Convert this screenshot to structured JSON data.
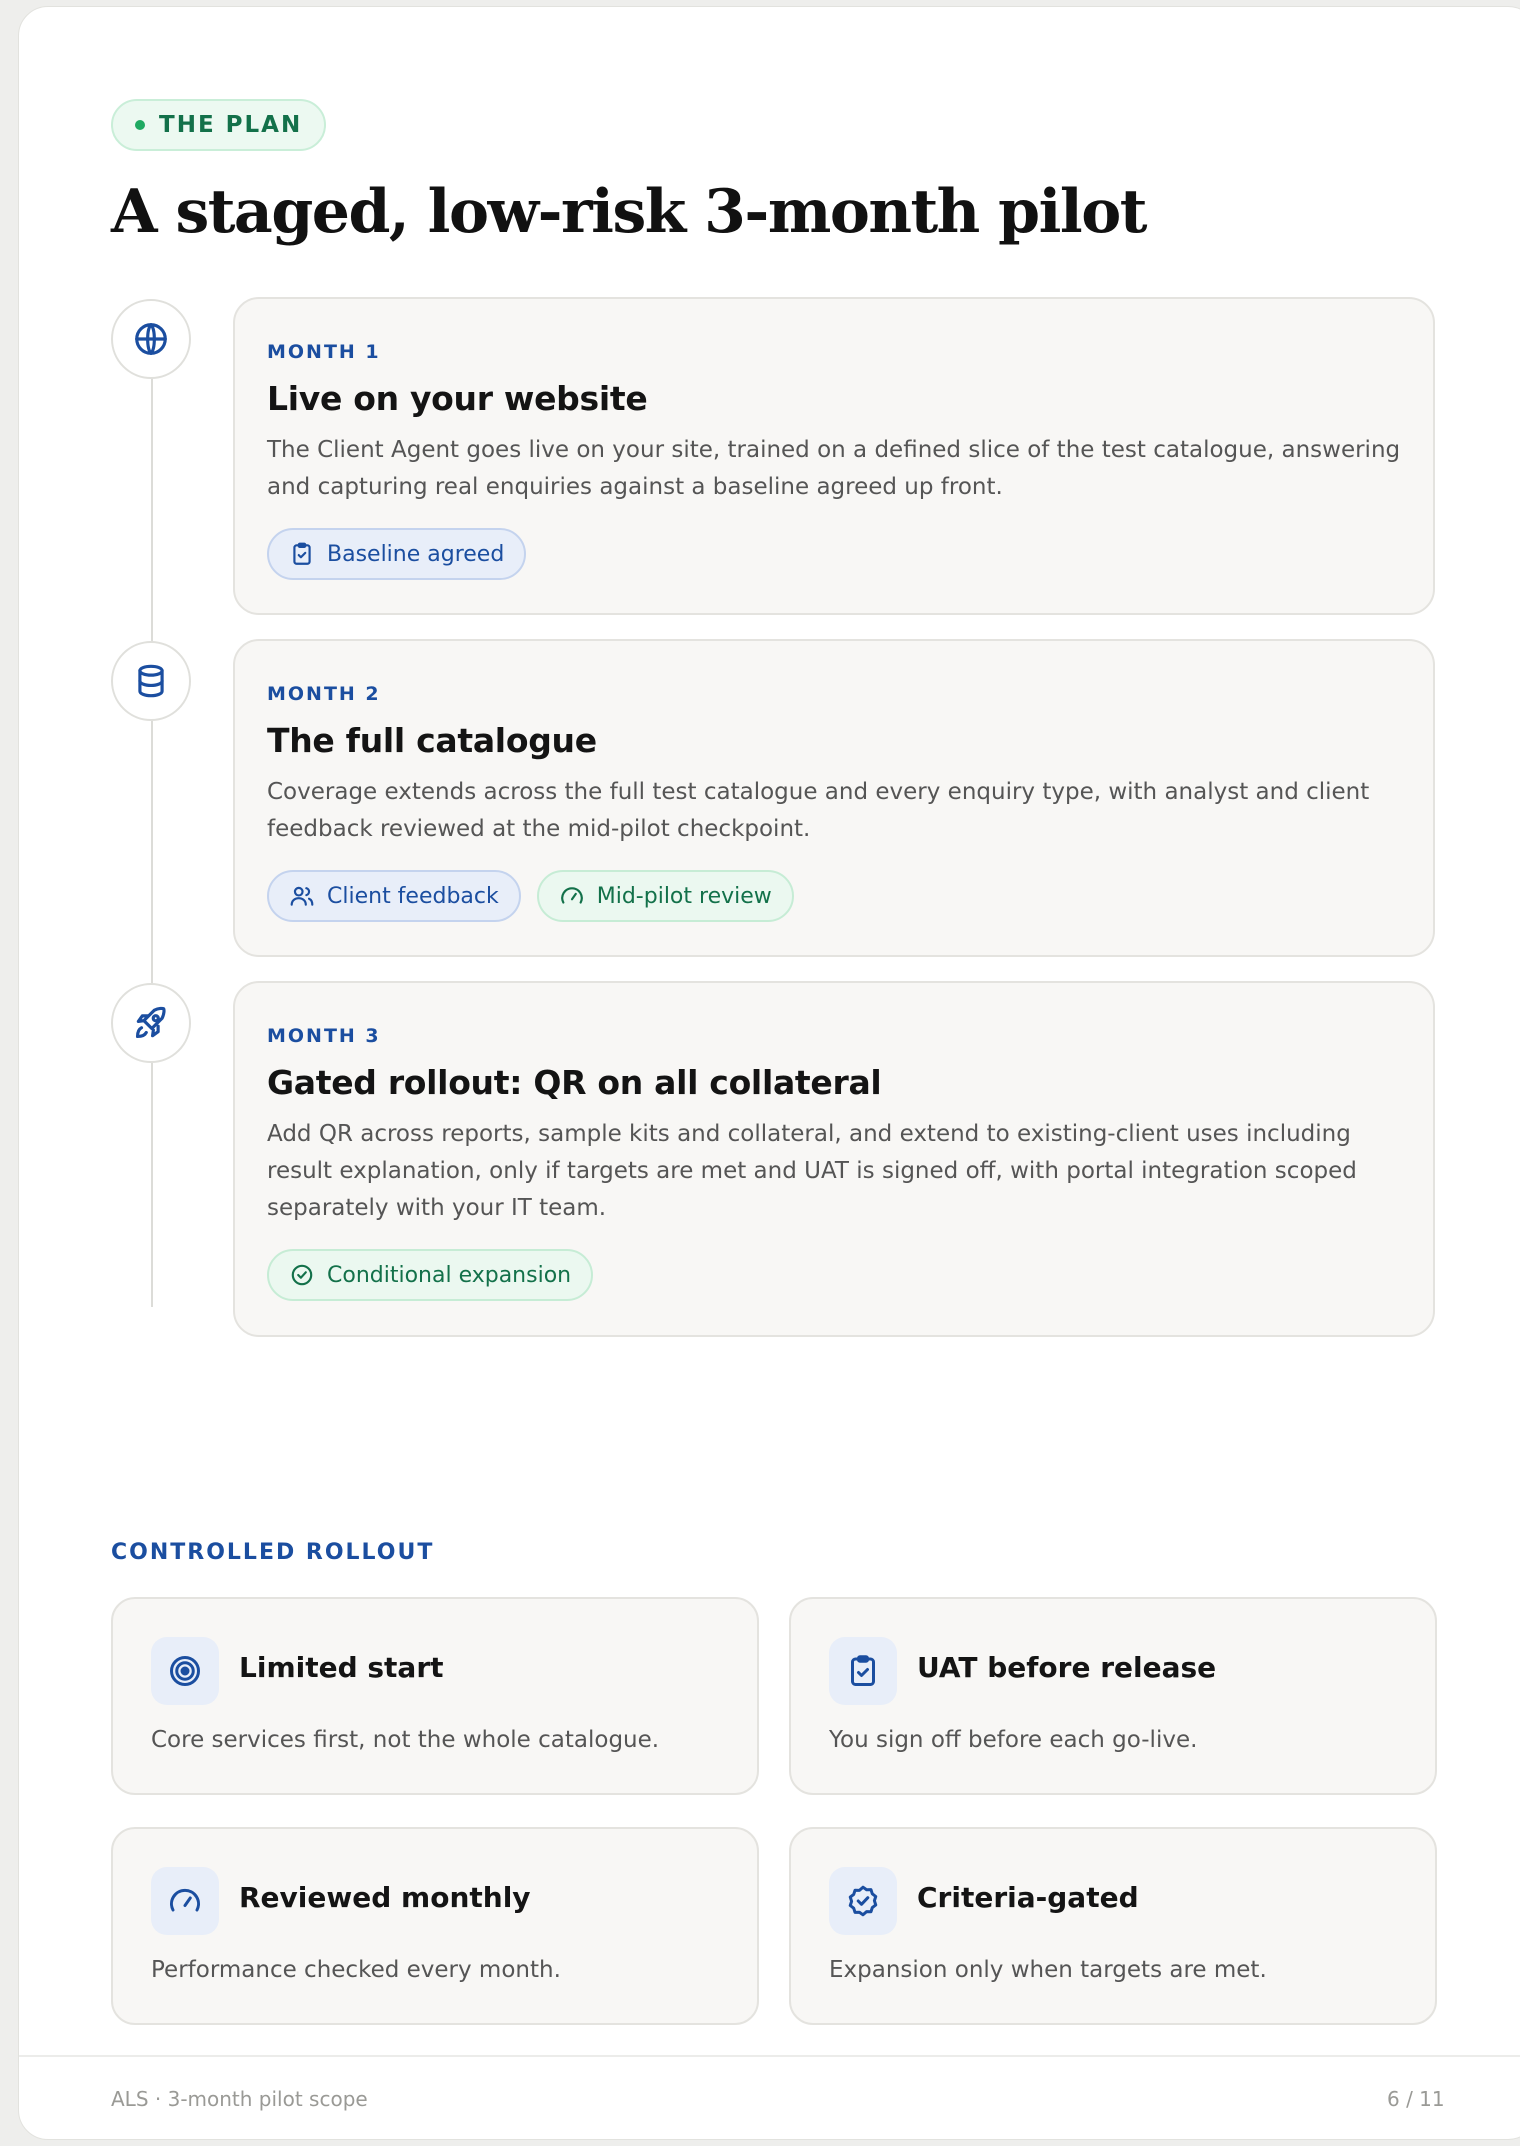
{
  "eyebrow": "THE PLAN",
  "title": "A staged, low-risk 3-month pilot",
  "months": [
    {
      "label": "MONTH 1",
      "heading": "Live on your website",
      "body": "The Client Agent goes live on your site, trained on a defined slice of the test catalogue, answering and capturing real enquiries against a baseline agreed up front.",
      "icon": "globe-icon",
      "tags": [
        {
          "label": "Baseline agreed",
          "icon": "clipboard-check-icon",
          "color": "#1b4ea0"
        }
      ]
    },
    {
      "label": "MONTH 2",
      "heading": "The full catalogue",
      "body": "Coverage extends across the full test catalogue and every enquiry type, with analyst and client feedback reviewed at the mid-pilot checkpoint.",
      "icon": "database-icon",
      "tags": [
        {
          "label": "Client feedback",
          "icon": "users-icon",
          "color": "#1b4ea0"
        },
        {
          "label": "Mid-pilot review",
          "icon": "gauge-icon",
          "color": "#13714a"
        }
      ]
    },
    {
      "label": "MONTH 3",
      "heading": "Gated rollout: QR on all collateral",
      "body": "Add QR across reports, sample kits and collateral, and extend to existing-client uses including result explanation, only if targets are met and UAT is signed off, with portal integration scoped separately with your IT team.",
      "icon": "rocket-icon",
      "tags": [
        {
          "label": "Conditional expansion",
          "icon": "badge-check-icon",
          "color": "#13714a"
        }
      ]
    }
  ],
  "rollout": {
    "label": "CONTROLLED ROLLOUT",
    "cards": [
      {
        "title": "Limited start",
        "desc": "Core services first, not the whole catalogue.",
        "icon": "target-icon"
      },
      {
        "title": "UAT before release",
        "desc": "You sign off before each go-live.",
        "icon": "clipboard-check-icon"
      },
      {
        "title": "Reviewed monthly",
        "desc": "Performance checked every month.",
        "icon": "gauge-icon"
      },
      {
        "title": "Criteria-gated",
        "desc": "Expansion only when targets are met.",
        "icon": "badge-check-icon"
      }
    ]
  },
  "footer": {
    "left": "ALS · 3-month pilot scope",
    "right": "6 / 11"
  },
  "colors": {
    "accent": "#1b4ea0",
    "green": "#13714a",
    "card_bg": "#f8f7f5"
  }
}
